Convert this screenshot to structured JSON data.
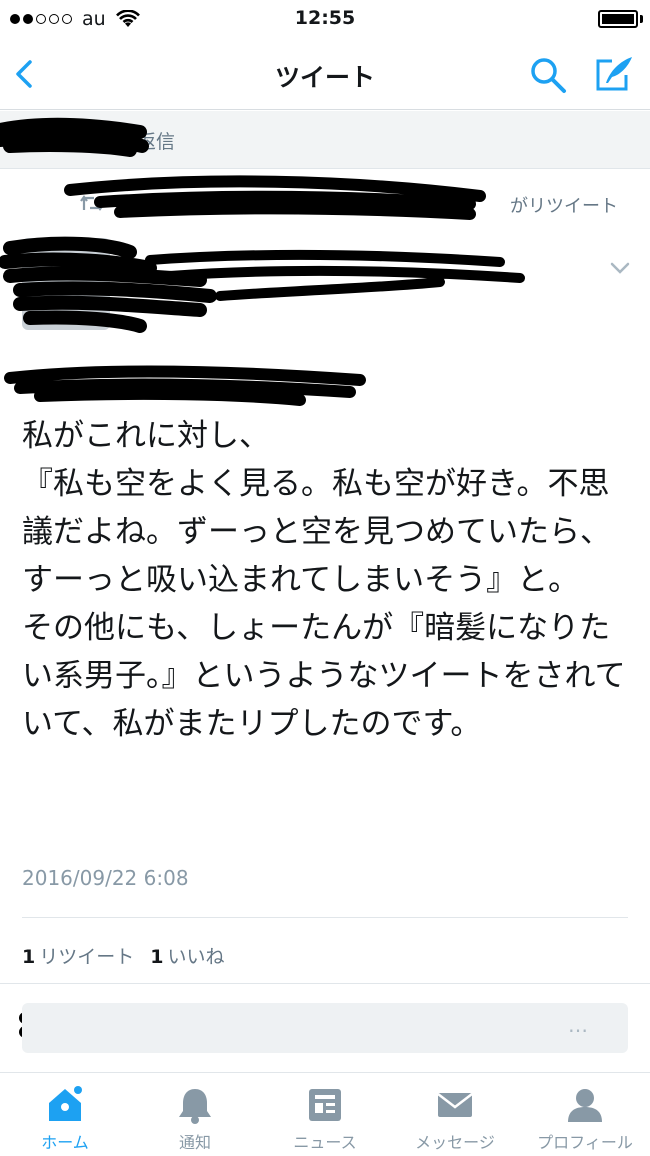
{
  "status_bar": {
    "carrier": "au",
    "time": "12:55"
  },
  "nav": {
    "title": "ツイート"
  },
  "reply_banner": {
    "text": "の返信"
  },
  "retweet": {
    "text": "がリツイート"
  },
  "tweet": {
    "text": "私がこれに対し、\n『私も空をよく見る。私も空が好き。不思議だよね。ずーっと空を見つめていたら、すーっと吸い込まれてしまいそう』と。\nその他にも、しょーたんが『暗髪になりたい系男子。』というようなツイートをされていて、私がまたリプしたのです。",
    "date": "2016/09/22 6:08",
    "retweet_count": "1",
    "retweet_label": "リツイート",
    "like_count": "1",
    "like_label": "いいね"
  },
  "tabs": [
    {
      "label": "ホーム",
      "icon": "home-icon",
      "active": true
    },
    {
      "label": "通知",
      "icon": "bell-icon",
      "active": false
    },
    {
      "label": "ニュース",
      "icon": "news-icon",
      "active": false
    },
    {
      "label": "メッセージ",
      "icon": "envelope-icon",
      "active": false
    },
    {
      "label": "プロフィール",
      "icon": "person-icon",
      "active": false
    }
  ],
  "colors": {
    "accent": "#1da1f2",
    "muted": "#8899a6",
    "text": "#14171a"
  }
}
